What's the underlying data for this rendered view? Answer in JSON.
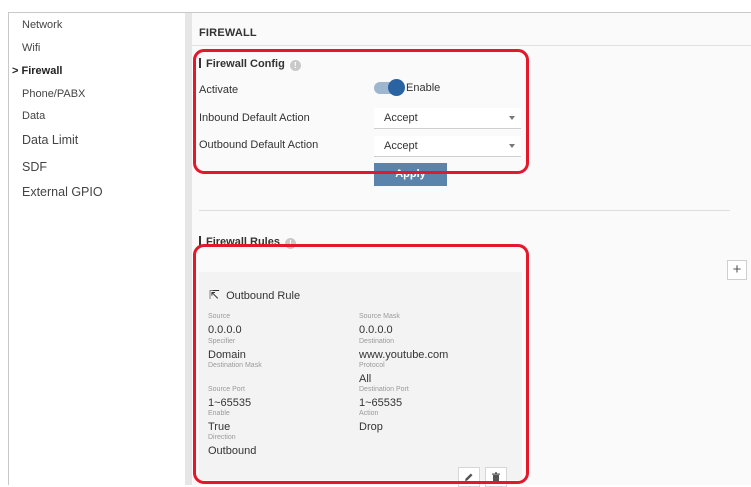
{
  "sidebar": {
    "items": [
      {
        "label": "Network",
        "active": false
      },
      {
        "label": "Wifi",
        "active": false
      },
      {
        "label": "> Firewall",
        "active": true
      },
      {
        "label": "Phone/PABX",
        "active": false
      },
      {
        "label": "Data",
        "active": false
      },
      {
        "label": "Data Limit",
        "active": false
      },
      {
        "label": "SDF",
        "active": false
      },
      {
        "label": "External GPIO",
        "active": false
      }
    ]
  },
  "page": {
    "title": "FIREWALL"
  },
  "config": {
    "section_title": "Firewall Config",
    "activate_label": "Activate",
    "toggle_label": "Enable",
    "toggle_on": true,
    "inbound_label": "Inbound Default Action",
    "inbound_value": "Accept",
    "outbound_label": "Outbound Default Action",
    "outbound_value": "Accept",
    "apply_label": "Apply"
  },
  "rules": {
    "section_title": "Firewall Rules",
    "add_label": "+",
    "rule": {
      "title": "Outbound Rule",
      "fields": {
        "source_label": "Source",
        "source": "0.0.0.0",
        "source_mask_label": "Source Mask",
        "source_mask": "0.0.0.0",
        "specifier_label": "Specifier",
        "specifier": "Domain",
        "destination_label": "Destination",
        "destination": "www.youtube.com",
        "destination_mask_label": "Destination Mask",
        "protocol_label": "Protocol",
        "protocol": "All",
        "source_port_label": "Source Port",
        "source_port": "1~65535",
        "destination_port_label": "Destination Port",
        "destination_port": "1~65535",
        "enable_label": "Enable",
        "enable": "True",
        "action_label": "Action",
        "action": "Drop",
        "direction_label": "Direction",
        "direction": "Outbound"
      }
    }
  },
  "colors": {
    "accent": "#2a63a2",
    "apply_button": "#5b84ad",
    "highlight": "#e4172b"
  },
  "icons": [
    "info-icon",
    "outbound-arrow-icon",
    "edit-icon",
    "delete-icon",
    "plus-icon",
    "chevron-down-icon"
  ]
}
